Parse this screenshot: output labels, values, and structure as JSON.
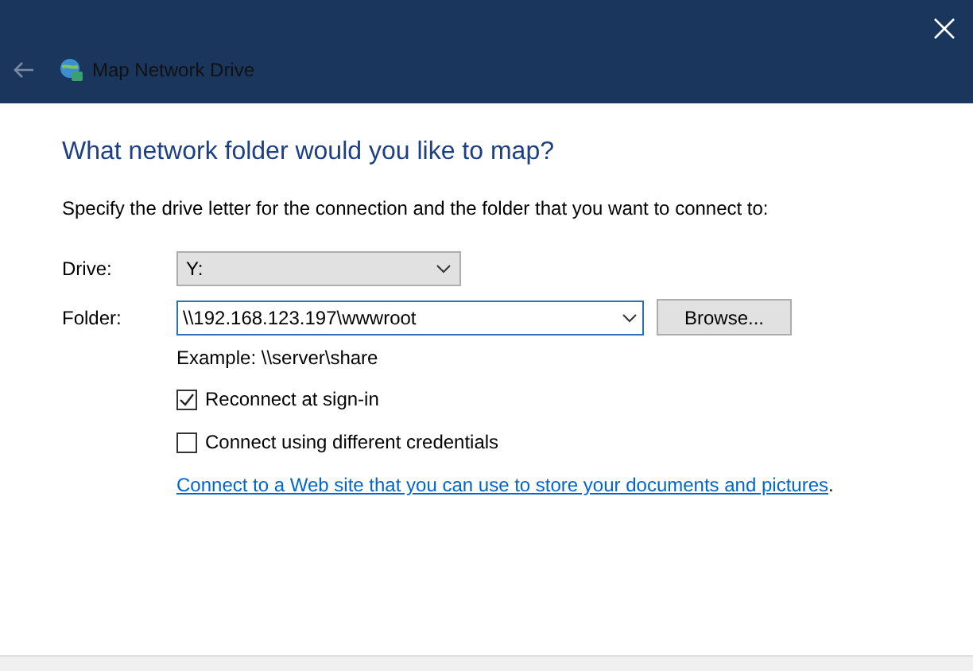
{
  "window": {
    "title": "Map Network Drive"
  },
  "heading": "What network folder would you like to map?",
  "instruction": "Specify the drive letter for the connection and the folder that you want to connect to:",
  "drive": {
    "label": "Drive:",
    "value": "Y:"
  },
  "folder": {
    "label": "Folder:",
    "value": "\\\\192.168.123.197\\wwwroot",
    "browse": "Browse..."
  },
  "example": "Example: \\\\server\\share",
  "options": [
    {
      "label": "Reconnect at sign-in",
      "checked": true
    },
    {
      "label": "Connect using different credentials",
      "checked": false
    }
  ],
  "link": "Connect to a Web site that you can use to store your documents and pictures",
  "link_end": "."
}
